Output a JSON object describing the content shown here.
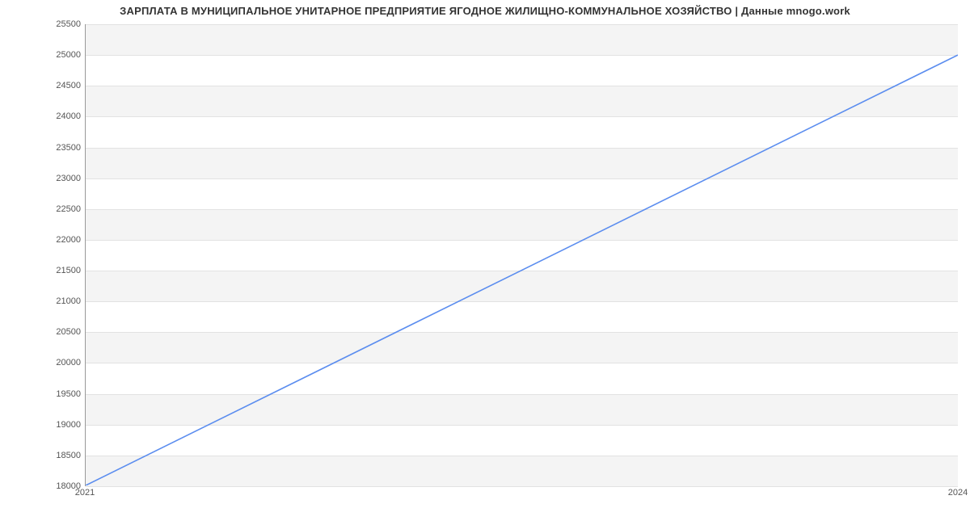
{
  "chart_data": {
    "type": "line",
    "title": "ЗАРПЛАТА В МУНИЦИПАЛЬНОЕ УНИТАРНОЕ ПРЕДПРИЯТИЕ ЯГОДНОЕ ЖИЛИЩНО-КОММУНАЛЬНОЕ ХОЗЯЙСТВО | Данные mnogo.work",
    "xlabel": "",
    "ylabel": "",
    "x": [
      2021,
      2024
    ],
    "values": [
      18000,
      25000
    ],
    "xlim": [
      2021,
      2024
    ],
    "ylim": [
      18000,
      25500
    ],
    "y_ticks": [
      18000,
      18500,
      19000,
      19500,
      20000,
      20500,
      21000,
      21500,
      22000,
      22500,
      23000,
      23500,
      24000,
      24500,
      25000,
      25500
    ],
    "x_ticks": [
      2021,
      2024
    ],
    "grid": true,
    "line_color": "#5b8def"
  }
}
